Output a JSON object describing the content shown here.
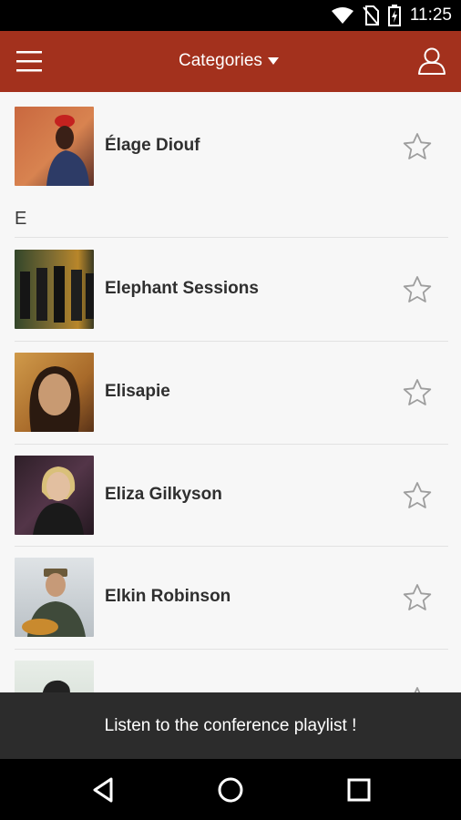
{
  "status_bar": {
    "time": "11:25",
    "icons": [
      "wifi-icon",
      "no-sim-icon",
      "battery-charging-icon"
    ]
  },
  "app_bar": {
    "title": "Categories",
    "menu_icon": "hamburger-menu-icon",
    "dropdown_icon": "caret-down-icon",
    "profile_icon": "user-profile-icon",
    "color": "#a3311d"
  },
  "list": {
    "section_letter": "E",
    "items": [
      {
        "name": "Élage Diouf"
      },
      {
        "name": "Elephant Sessions"
      },
      {
        "name": "Elisapie"
      },
      {
        "name": "Eliza Gilkyson"
      },
      {
        "name": "Elkin Robinson"
      },
      {
        "name": ""
      }
    ]
  },
  "banner": {
    "text": "Listen to the conference playlist !"
  },
  "nav_bar": {
    "icons": [
      "back-icon",
      "home-icon",
      "recents-icon"
    ]
  }
}
